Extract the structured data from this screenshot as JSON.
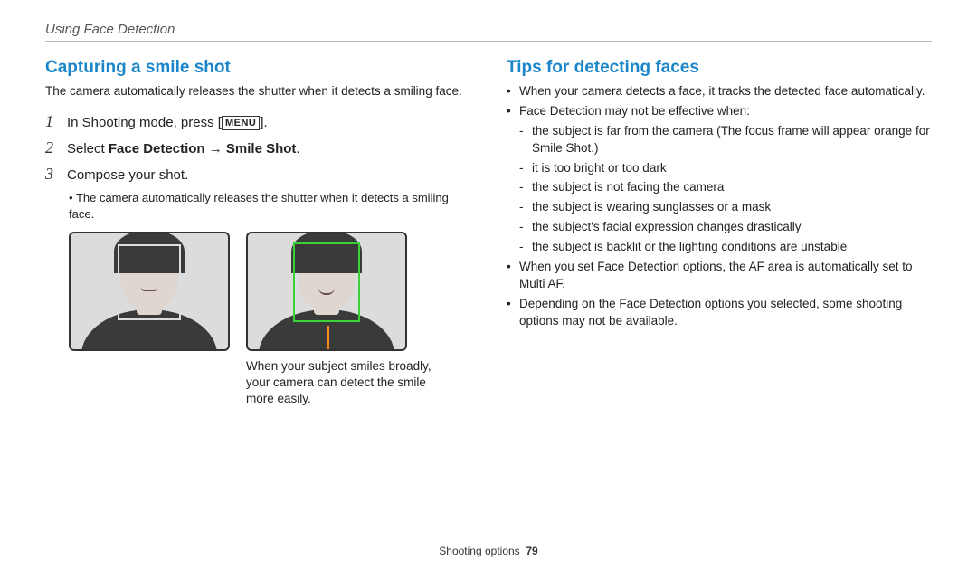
{
  "breadcrumb": "Using Face Detection",
  "left": {
    "title": "Capturing a smile shot",
    "intro": "The camera automatically releases the shutter when it detects a smiling face.",
    "steps": {
      "s1_num": "1",
      "s1_a": "In Shooting mode, press [",
      "s1_menu": "MENU",
      "s1_b": "].",
      "s2_num": "2",
      "s2_a": "Select ",
      "s2_b": "Face Detection",
      "s2_arrow": " → ",
      "s2_c": "Smile Shot",
      "s2_d": ".",
      "s3_num": "3",
      "s3": "Compose your shot.",
      "s3_sub": "The camera automatically releases the shutter when it detects a smiling face."
    },
    "caption": "When your subject smiles broadly, your camera can detect the smile more easily."
  },
  "right": {
    "title": "Tips for detecting faces",
    "b1": "When your camera detects a face, it tracks the detected face automatically.",
    "b2": "Face Detection may not be effective when:",
    "b2_sub": {
      "a": "the subject is far from the camera (The focus frame will appear orange for Smile Shot.)",
      "b": "it is too bright or too dark",
      "c": "the subject is not facing the camera",
      "d": "the subject is wearing sunglasses or a mask",
      "e": "the subject's facial expression changes drastically",
      "f": "the subject is backlit or the lighting conditions are unstable"
    },
    "b3": "When you set Face Detection options, the AF area is automatically set to Multi AF.",
    "b4": "Depending on the Face Detection options you selected, some shooting options may not be available."
  },
  "footer": {
    "section": "Shooting options",
    "page": "79"
  }
}
